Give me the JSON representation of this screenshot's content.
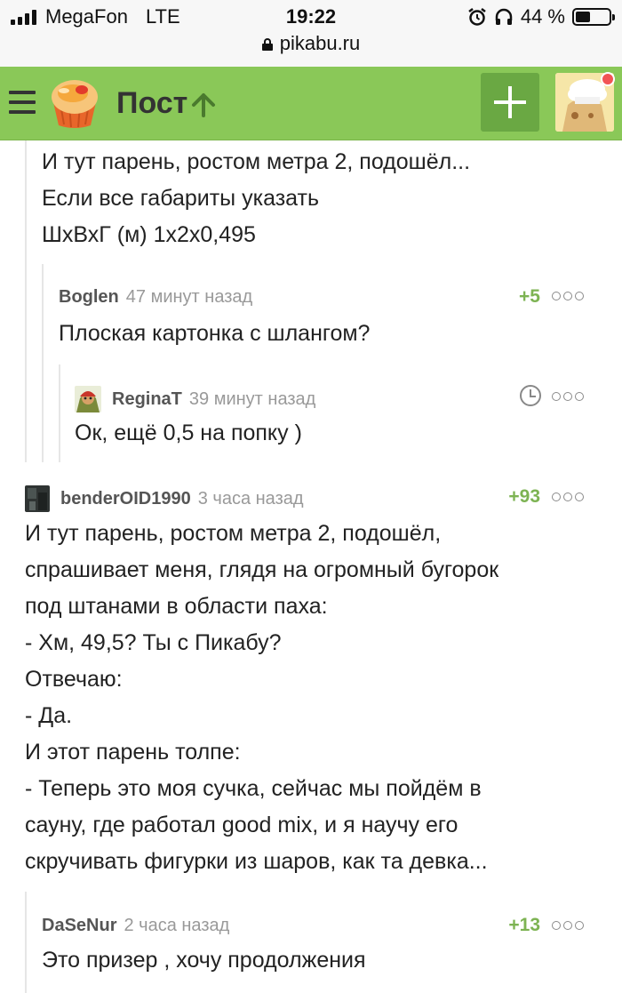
{
  "status_bar": {
    "carrier": "MegaFon",
    "network": "LTE",
    "time": "19:22",
    "battery": "44 %",
    "battery_level": 0.44,
    "url": "pikabu.ru",
    "icons": [
      "signal-icon",
      "alarm-icon",
      "headphones-icon",
      "battery-icon",
      "lock-icon"
    ]
  },
  "header": {
    "title": "Пост",
    "colors": {
      "bar": "#8ac858",
      "add_button": "#6aa843",
      "notification": "#f25454"
    },
    "icons": [
      "menu-icon",
      "pikabu-logo",
      "arrow-up-icon",
      "plus-icon",
      "avatar"
    ]
  },
  "comments": [
    {
      "lines": [
        "И тут парень, ростом метра 2, подошёл...",
        "Если все габариты указать",
        "ШхВхГ (м) 1х2х0,495"
      ]
    },
    {
      "author": "Boglen",
      "time": "47 минут назад",
      "rating": "+5",
      "lines": [
        "Плоская картонка с шлангом?"
      ]
    },
    {
      "author": "ReginaT",
      "time": "39 минут назад",
      "lines": [
        "Ок, ещё 0,5 на попку )"
      ]
    },
    {
      "author": "benderOID1990",
      "time": "3 часа назад",
      "rating": "+93",
      "lines": [
        "И тут парень, ростом метра 2, подошёл,",
        "спрашивает меня, глядя на огромный бугорок",
        "под штанами в области паха:",
        "- Хм, 49,5? Ты с Пикабу?",
        "Отвечаю:",
        "- Да.",
        "И этот парень толпе:",
        "- Теперь это моя сучка, сейчас мы пойдём в",
        "сауну, где работал good mix, и я научу его",
        "скручивать фигурки из шаров, как та девка..."
      ]
    },
    {
      "author": "DaSeNur",
      "time": "2 часа назад",
      "rating": "+13",
      "lines": [
        "Это призер , хочу продолжения"
      ]
    }
  ],
  "accent_color": "#7db353"
}
